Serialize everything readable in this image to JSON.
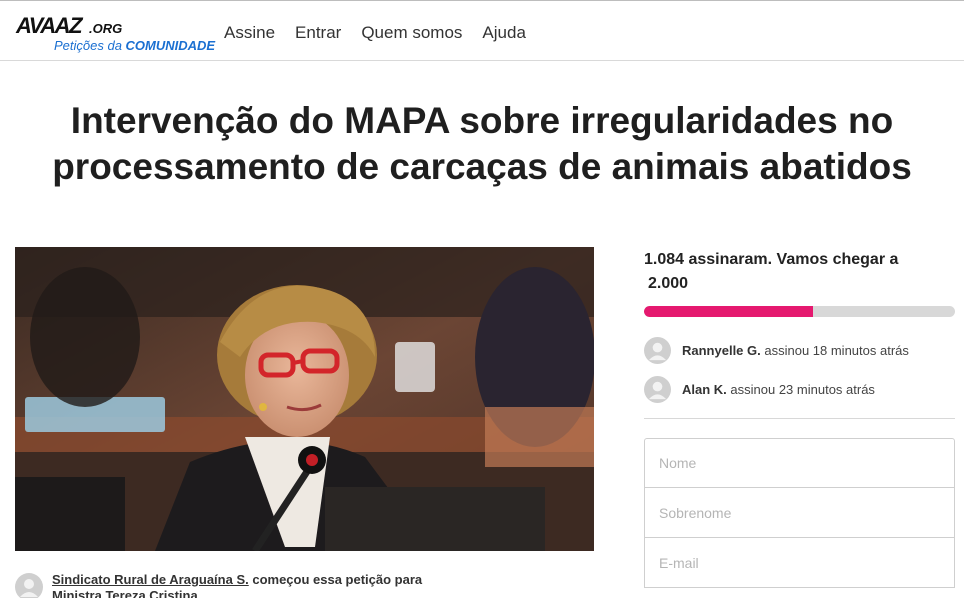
{
  "header": {
    "logo_wordmark": "AVAAZ",
    "logo_suffix": ".ORG",
    "logo_tagline_prefix": "Petições da ",
    "logo_tagline_bold": "COMUNIDADE",
    "nav": [
      "Assine",
      "Entrar",
      "Quem somos",
      "Ajuda"
    ]
  },
  "petition": {
    "title_line1": "Intervenção do MAPA sobre irregularidades no",
    "title_line2": "processamento de carcaças de animais abatidos",
    "starter_name": "Sindicato Rural de Araguaína S.",
    "starter_text": " começou essa petição para",
    "target": "Ministra Tereza Cristina"
  },
  "signatures": {
    "count_text": "1.084 assinaram. Vamos chegar a",
    "goal_text": "2.000",
    "progress_fraction": 0.542,
    "colors": {
      "fill": "#e5196f",
      "track": "#d8d8d8"
    },
    "recent": [
      {
        "name": "Rannyelle G.",
        "action": " assinou 18 minutos atrás"
      },
      {
        "name": "Alan K.",
        "action": " assinou 23 minutos atrás"
      }
    ]
  },
  "form": {
    "first_name_placeholder": "Nome",
    "last_name_placeholder": "Sobrenome",
    "email_placeholder": "E-mail"
  }
}
